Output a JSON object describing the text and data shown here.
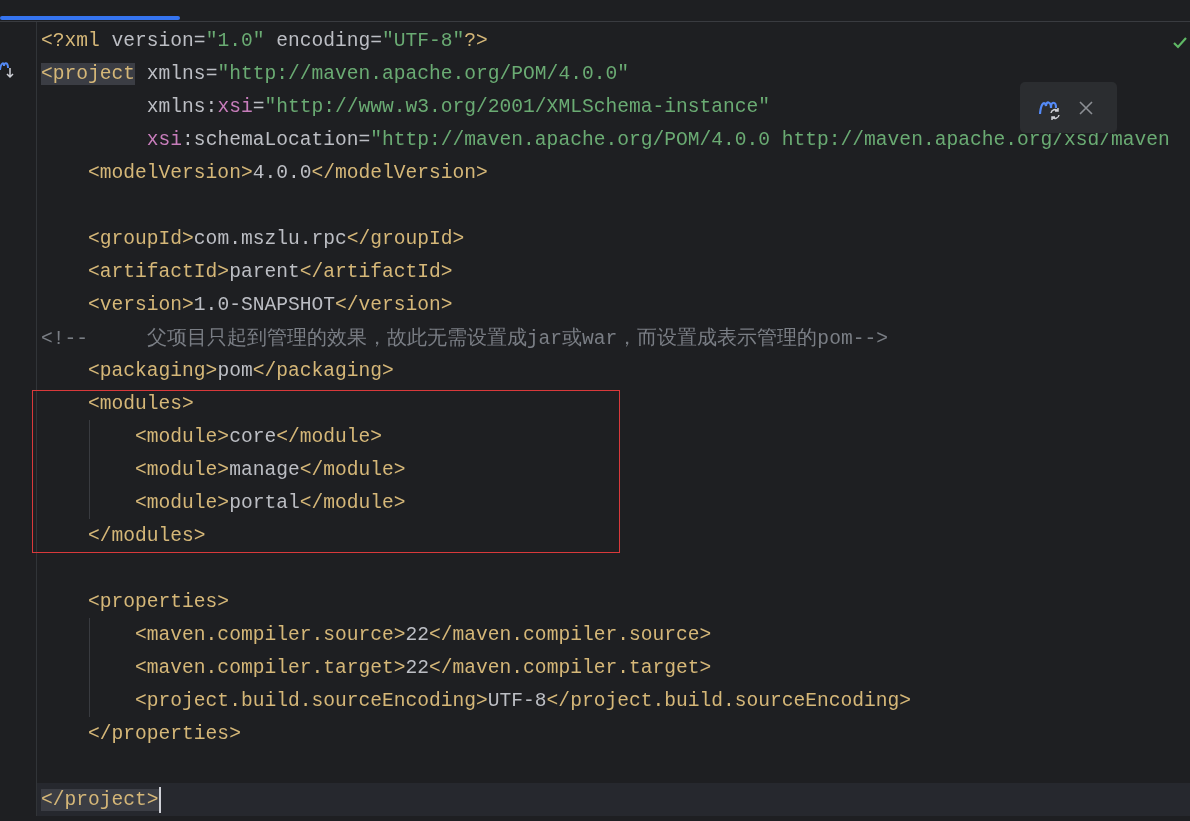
{
  "editor": {
    "lines": [
      {
        "current": false,
        "tokens": [
          {
            "kind": "tag",
            "text": "<?xml "
          },
          {
            "kind": "attr",
            "text": "version="
          },
          {
            "kind": "value",
            "text": "\"1.0\" "
          },
          {
            "kind": "attr",
            "text": "encoding="
          },
          {
            "kind": "value",
            "text": "\"UTF-8\""
          },
          {
            "kind": "tag",
            "text": "?>"
          }
        ]
      },
      {
        "current": false,
        "tokens": [
          {
            "kind": "tag",
            "text": "<project",
            "matched": true
          },
          {
            "kind": "attr",
            "text": " xmlns="
          },
          {
            "kind": "value",
            "text": "\"http://maven.apache.org/POM/4.0.0\""
          }
        ]
      },
      {
        "current": false,
        "tokens": [
          {
            "kind": "attr",
            "text": "         xmlns:"
          },
          {
            "kind": "ns",
            "text": "xsi"
          },
          {
            "kind": "attr",
            "text": "="
          },
          {
            "kind": "value",
            "text": "\"http://www.w3.org/2001/XMLSchema-instance\""
          }
        ]
      },
      {
        "current": false,
        "tokens": [
          {
            "kind": "ns",
            "text": "         xsi"
          },
          {
            "kind": "attr",
            "text": ":schemaLocation="
          },
          {
            "kind": "value",
            "text": "\"http://maven.apache.org/POM/4.0.0 http://maven.apache.org/xsd/maven"
          }
        ]
      },
      {
        "current": false,
        "tokens": [
          {
            "kind": "tag",
            "text": "    <modelVersion>"
          },
          {
            "kind": "text",
            "text": "4.0.0"
          },
          {
            "kind": "tag",
            "text": "</modelVersion>"
          }
        ]
      },
      {
        "current": false
      },
      {
        "current": false,
        "tokens": [
          {
            "kind": "tag",
            "text": "    <groupId>"
          },
          {
            "kind": "text",
            "text": "com.mszlu.rpc"
          },
          {
            "kind": "tag",
            "text": "</groupId>"
          }
        ]
      },
      {
        "current": false,
        "tokens": [
          {
            "kind": "tag",
            "text": "    <artifactId>"
          },
          {
            "kind": "text",
            "text": "parent"
          },
          {
            "kind": "tag",
            "text": "</artifactId>"
          }
        ]
      },
      {
        "current": false,
        "tokens": [
          {
            "kind": "tag",
            "text": "    <version>"
          },
          {
            "kind": "text",
            "text": "1.0-SNAPSHOT"
          },
          {
            "kind": "tag",
            "text": "</version>"
          }
        ]
      },
      {
        "current": false,
        "tokens": [
          {
            "kind": "comment",
            "text": "<!--     父项目只起到管理的效果，故此无需设置成jar或war，而设置成表示管理的pom-->"
          }
        ]
      },
      {
        "current": false,
        "tokens": [
          {
            "kind": "tag",
            "text": "    <packaging>"
          },
          {
            "kind": "text",
            "text": "pom"
          },
          {
            "kind": "tag",
            "text": "</packaging>"
          }
        ]
      },
      {
        "current": false,
        "tokens": [
          {
            "kind": "tag",
            "text": "    <modules>"
          }
        ]
      },
      {
        "current": false,
        "tokens": [
          {
            "kind": "tag",
            "text": "        <module>"
          },
          {
            "kind": "text",
            "text": "core"
          },
          {
            "kind": "tag",
            "text": "</module>"
          }
        ]
      },
      {
        "current": false,
        "tokens": [
          {
            "kind": "tag",
            "text": "        <module>"
          },
          {
            "kind": "text",
            "text": "manage"
          },
          {
            "kind": "tag",
            "text": "</module>"
          }
        ]
      },
      {
        "current": false,
        "tokens": [
          {
            "kind": "tag",
            "text": "        <module>"
          },
          {
            "kind": "text",
            "text": "portal"
          },
          {
            "kind": "tag",
            "text": "</module>"
          }
        ]
      },
      {
        "current": false,
        "tokens": [
          {
            "kind": "tag",
            "text": "    </modules>"
          }
        ]
      },
      {
        "current": false
      },
      {
        "current": false,
        "tokens": [
          {
            "kind": "tag",
            "text": "    <properties>"
          }
        ]
      },
      {
        "current": false,
        "tokens": [
          {
            "kind": "tag",
            "text": "        <maven.compiler.source>"
          },
          {
            "kind": "text",
            "text": "22"
          },
          {
            "kind": "tag",
            "text": "</maven.compiler.source>"
          }
        ]
      },
      {
        "current": false,
        "tokens": [
          {
            "kind": "tag",
            "text": "        <maven.compiler.target>"
          },
          {
            "kind": "text",
            "text": "22"
          },
          {
            "kind": "tag",
            "text": "</maven.compiler.target>"
          }
        ]
      },
      {
        "current": false,
        "tokens": [
          {
            "kind": "tag",
            "text": "        <project.build.sourceEncoding>"
          },
          {
            "kind": "text",
            "text": "UTF-8"
          },
          {
            "kind": "tag",
            "text": "</project.build.sourceEncoding>"
          }
        ]
      },
      {
        "current": false,
        "tokens": [
          {
            "kind": "tag",
            "text": "    </properties>"
          }
        ]
      },
      {
        "current": false
      },
      {
        "current": true,
        "tokens": [
          {
            "kind": "tag",
            "text": "</project>",
            "matched": true
          }
        ]
      }
    ]
  }
}
